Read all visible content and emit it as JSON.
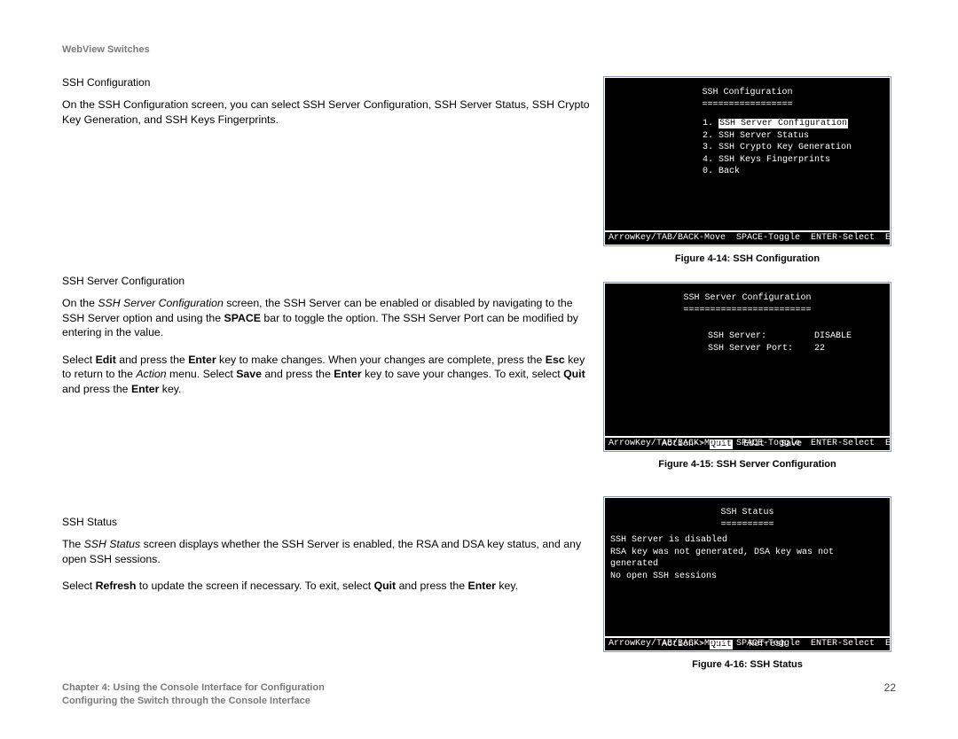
{
  "header": {
    "product": "WebView Switches"
  },
  "section_a": {
    "heading": "SSH Configuration",
    "para": "On the SSH Configuration screen, you can select SSH Server Configuration, SSH Server Status, SSH Crypto Key Generation, and SSH Keys Fingerprints."
  },
  "section_b": {
    "heading": "SSH Server Configuration",
    "para1_before_italic": "On the ",
    "para1_italic": "SSH Server Configuration",
    "para1_after_italic": " screen, the SSH Server can be enabled or disabled by navigating to the SSH Server option and using the ",
    "para1_bold1": "SPACE",
    "para1_after_bold1": " bar to toggle the option. The SSH Server Port can be modified by entering in the value.",
    "para2_a": "Select ",
    "para2_b1": "Edit",
    "para2_b": " and press the ",
    "para2_b2": "Enter",
    "para2_c": " key to make changes. When your changes are complete, press the ",
    "para2_b3": "Esc",
    "para2_d": " key to return to the ",
    "para2_italic": "Action",
    "para2_e": " menu. Select ",
    "para2_b4": "Save",
    "para2_f": " and press the ",
    "para2_b5": "Enter",
    "para2_g": " key to save your changes. To exit, select ",
    "para2_b6": "Quit",
    "para2_h": " and press the ",
    "para2_b7": "Enter",
    "para2_i": " key."
  },
  "section_c": {
    "heading": "SSH Status",
    "para1_a": "The ",
    "para1_italic": "SSH Status",
    "para1_b": " screen displays whether the SSH Server is enabled, the RSA and DSA key status, and any open SSH sessions.",
    "para2_a": "Select ",
    "para2_b1": "Refresh",
    "para2_b": " to update the screen if necessary. To exit, select ",
    "para2_b2": "Quit",
    "para2_c": " and press the ",
    "para2_b3": "Enter",
    "para2_d": " key."
  },
  "figure14": {
    "caption": "Figure 4-14: SSH Configuration",
    "title": "SSH Configuration",
    "underline": "=================",
    "items": [
      {
        "num": "1.",
        "label": "SSH Server Configuration",
        "selected": true
      },
      {
        "num": "2.",
        "label": "SSH Server Status",
        "selected": false
      },
      {
        "num": "3.",
        "label": "SSH Crypto Key Generation",
        "selected": false
      },
      {
        "num": "4.",
        "label": "SSH Keys Fingerprints",
        "selected": false
      },
      {
        "num": "0.",
        "label": "Back",
        "selected": false
      }
    ],
    "helpbar": "ArrowKey/TAB/BACK-Move  SPACE-Toggle  ENTER-Select  ESC-Back"
  },
  "figure15": {
    "caption": "Figure 4-15: SSH Server Configuration",
    "title": "SSH Server Configuration",
    "underline": "========================",
    "rows": [
      {
        "label": "SSH Server:",
        "value": "DISABLE"
      },
      {
        "label": "SSH Server Port:",
        "value": "22"
      }
    ],
    "action_prefix": "Action->",
    "action_sel": "Quit",
    "action_rest": "  Edit   Save",
    "helpbar": "ArrowKey/TAB/BACK-Move  SPACE-Toggle  ENTER-Select  ESC-Back"
  },
  "figure16": {
    "caption": "Figure 4-16: SSH Status",
    "title": "SSH Status",
    "underline": "==========",
    "lines": [
      "SSH Server is disabled",
      "RSA key was not generated, DSA key was not generated",
      "No open SSH sessions"
    ],
    "action_prefix": "Action->",
    "action_sel": "Quit",
    "action_rest": "   Refresh",
    "helpbar": "ArrowKey/TAB/BACK-Move  SPACE-Toggle  ENTER-Select  ESC-Back"
  },
  "footer": {
    "line1": "Chapter 4: Using the Console Interface for Configuration",
    "line2": "Configuring the Switch through the Console Interface",
    "page": "22"
  }
}
